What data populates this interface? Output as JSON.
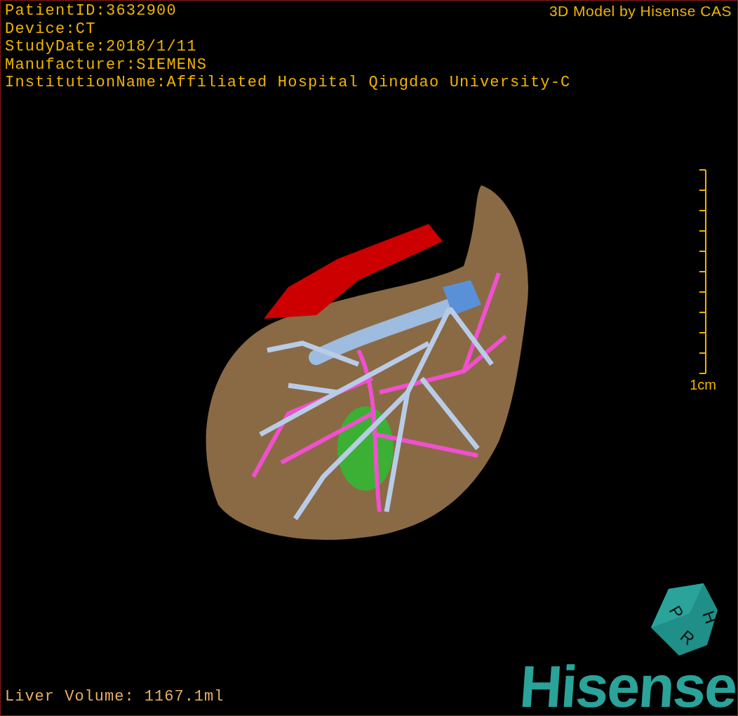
{
  "info_lines": [
    "PatientID:3632900",
    "Device:CT",
    "StudyDate:2018/1/11",
    "Manufacturer:SIEMENS",
    "InstitutionName:Affiliated Hospital Qingdao University-C"
  ],
  "title": "3D Model by Hisense CAS",
  "scale_label": "1cm",
  "liver_volume": "Liver Volume: 1167.1ml",
  "cube_labels": [
    "P",
    "H",
    "R"
  ],
  "logo": "Hisense"
}
